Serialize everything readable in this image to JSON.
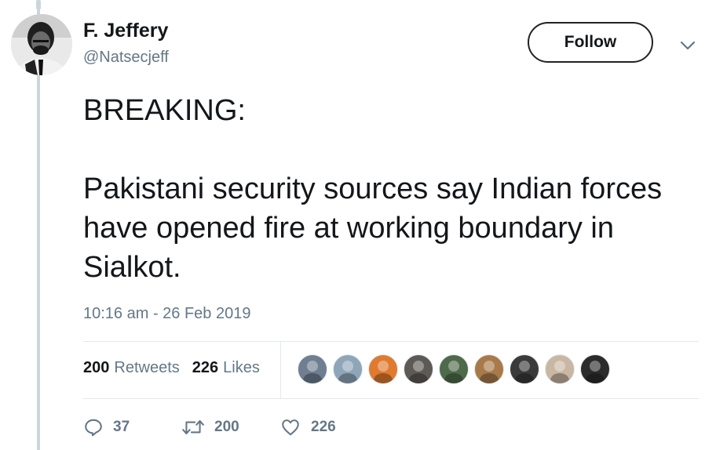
{
  "author": {
    "name": "F. Jeffery",
    "handle": "@Natsecjeff"
  },
  "follow_label": "Follow",
  "tweet": {
    "line1": "BREAKING:",
    "line2": "Pakistani security sources say Indian forces have opened fire at working boundary in Sialkot."
  },
  "timestamp": "10:16 am - 26 Feb 2019",
  "stats": {
    "retweets_count": "200",
    "retweets_label": "Retweets",
    "likes_count": "226",
    "likes_label": "Likes"
  },
  "likers": [
    {
      "icon": "avatar-1",
      "bg": "#6f7e90"
    },
    {
      "icon": "avatar-2",
      "bg": "#8fa6b8"
    },
    {
      "icon": "avatar-3",
      "bg": "#e07a2f"
    },
    {
      "icon": "avatar-4",
      "bg": "#5d5a55"
    },
    {
      "icon": "avatar-5",
      "bg": "#4f6a4a"
    },
    {
      "icon": "avatar-6",
      "bg": "#a87a4a"
    },
    {
      "icon": "avatar-7",
      "bg": "#3a3a3a"
    },
    {
      "icon": "avatar-8",
      "bg": "#c9b7a3"
    },
    {
      "icon": "avatar-9",
      "bg": "#2b2b2b"
    }
  ],
  "actions": {
    "replies": "37",
    "retweets": "200",
    "likes": "226"
  },
  "colors": {
    "text": "#14171a",
    "secondary": "#657786",
    "border": "#e1e8ed",
    "thread_line": "#ccd6dd"
  }
}
